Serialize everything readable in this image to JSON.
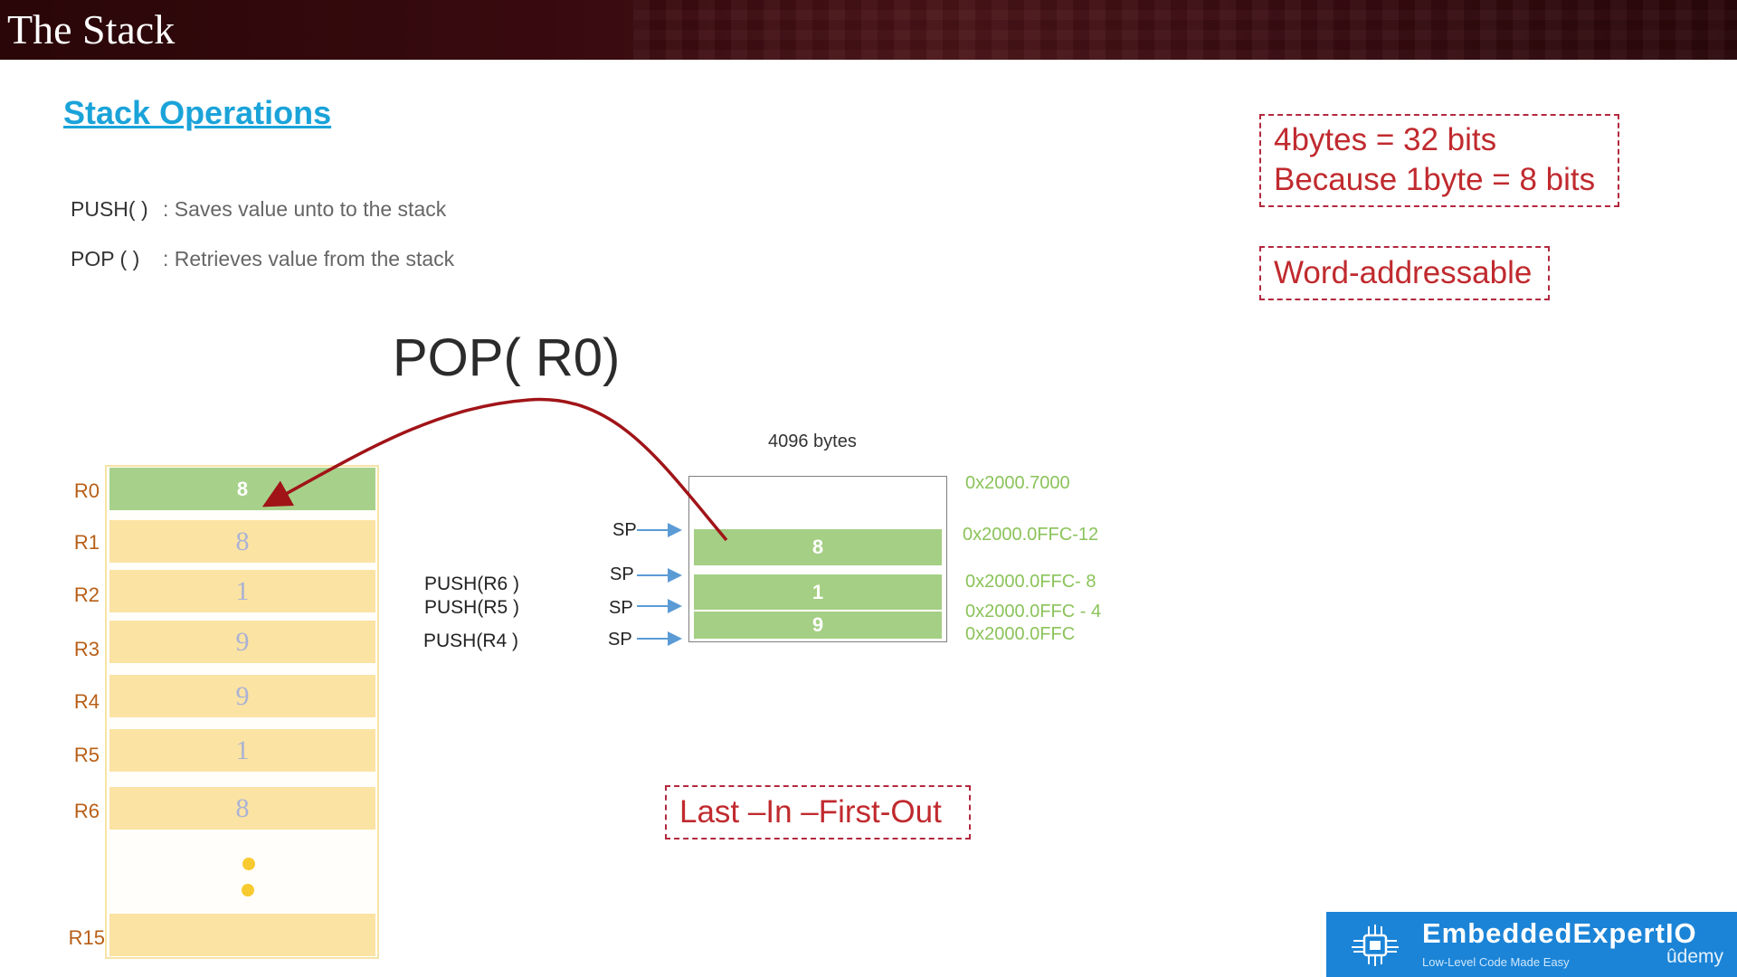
{
  "slide": {
    "title": "The Stack",
    "section_heading": "Stack Operations",
    "operations": [
      {
        "name": "PUSH( )",
        "description": ": Saves value unto to the stack"
      },
      {
        "name": "POP ( )",
        "description": ": Retrieves value from the stack"
      }
    ],
    "current_operation": "POP( R0)",
    "notes": {
      "bits_line1": "4bytes  = 32 bits",
      "bits_line2": "Because 1byte = 8 bits",
      "word_addressable": "Word-addressable",
      "lifo": "Last –In –First-Out"
    }
  },
  "registers": [
    {
      "name": "R0",
      "value": "8",
      "highlight": true
    },
    {
      "name": "R1",
      "value": "8"
    },
    {
      "name": "R2",
      "value": "1"
    },
    {
      "name": "R3",
      "value": "9"
    },
    {
      "name": "R4",
      "value": "9"
    },
    {
      "name": "R5",
      "value": "1"
    },
    {
      "name": "R6",
      "value": "8"
    },
    {
      "name": "R15",
      "value": ""
    }
  ],
  "stack": {
    "size_label": "4096 bytes",
    "cells": [
      "8",
      "1",
      "9"
    ],
    "addresses": [
      "0x2000.7000",
      "0x2000.0FFC-12",
      "0x2000.0FFC- 8",
      "0x2000.0FFC - 4",
      "0x2000.0FFC"
    ],
    "sp_label": "SP",
    "push_ops": [
      "PUSH(R6 )",
      "PUSH(R5 )",
      "PUSH(R4 )"
    ]
  },
  "logo": {
    "name": "EmbeddedExpertIO",
    "tagline": "Low-Level Code Made Easy",
    "platform": "ûdemy"
  },
  "colors": {
    "title_bar": "#3a0b10",
    "heading_blue": "#1aa3d9",
    "note_red": "#c02a2e",
    "register_yellow": "#fbe3a3",
    "stack_green": "#a5cf84",
    "address_green": "#8bc35a",
    "arrow_red": "#a01418",
    "sp_arrow_blue": "#5b9bd5",
    "logo_blue": "#1b84d7"
  }
}
